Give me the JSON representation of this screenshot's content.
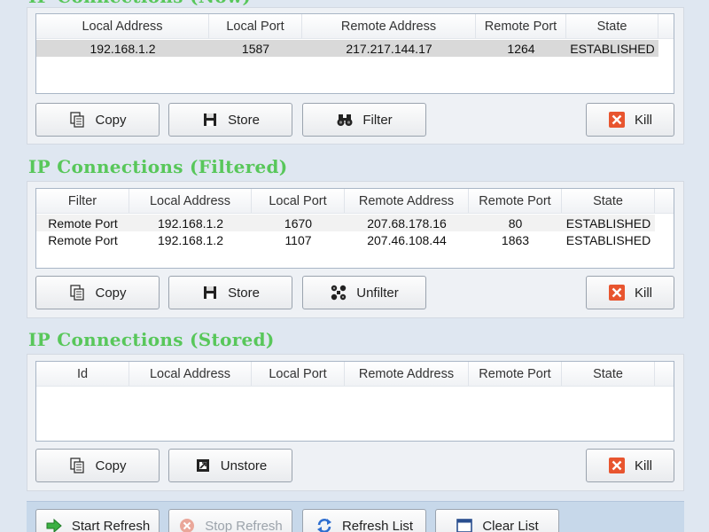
{
  "sections": {
    "top": {
      "title": "IP Connections (Now)",
      "columns": [
        "Local Address",
        "Local Port",
        "Remote Address",
        "Remote Port",
        "State"
      ],
      "rows": [
        [
          "192.168.1.2",
          "1587",
          "217.217.144.17",
          "1264",
          "ESTABLISHED"
        ]
      ],
      "buttons": {
        "copy": "Copy",
        "store": "Store",
        "filter": "Filter",
        "kill": "Kill"
      }
    },
    "filtered": {
      "title": "IP Connections (Filtered)",
      "columns": [
        "Filter",
        "Local Address",
        "Local Port",
        "Remote Address",
        "Remote Port",
        "State"
      ],
      "rows": [
        [
          "Remote Port",
          "192.168.1.2",
          "1670",
          "207.68.178.16",
          "80",
          "ESTABLISHED"
        ],
        [
          "Remote Port",
          "192.168.1.2",
          "1107",
          "207.46.108.44",
          "1863",
          "ESTABLISHED"
        ]
      ],
      "buttons": {
        "copy": "Copy",
        "store": "Store",
        "unfilter": "Unfilter",
        "kill": "Kill"
      }
    },
    "stored": {
      "title": "IP Connections (Stored)",
      "columns": [
        "Id",
        "Local Address",
        "Local Port",
        "Remote Address",
        "Remote Port",
        "State"
      ],
      "rows": [],
      "buttons": {
        "copy": "Copy",
        "unstore": "Unstore",
        "kill": "Kill"
      }
    }
  },
  "footer": {
    "start_refresh": "Start Refresh",
    "stop_refresh": "Stop Refresh",
    "refresh_list": "Refresh List",
    "clear_list": "Clear List"
  },
  "colors": {
    "title_green": "#58c75a",
    "kill_red": "#e8552f",
    "start_green": "#3cb043"
  }
}
